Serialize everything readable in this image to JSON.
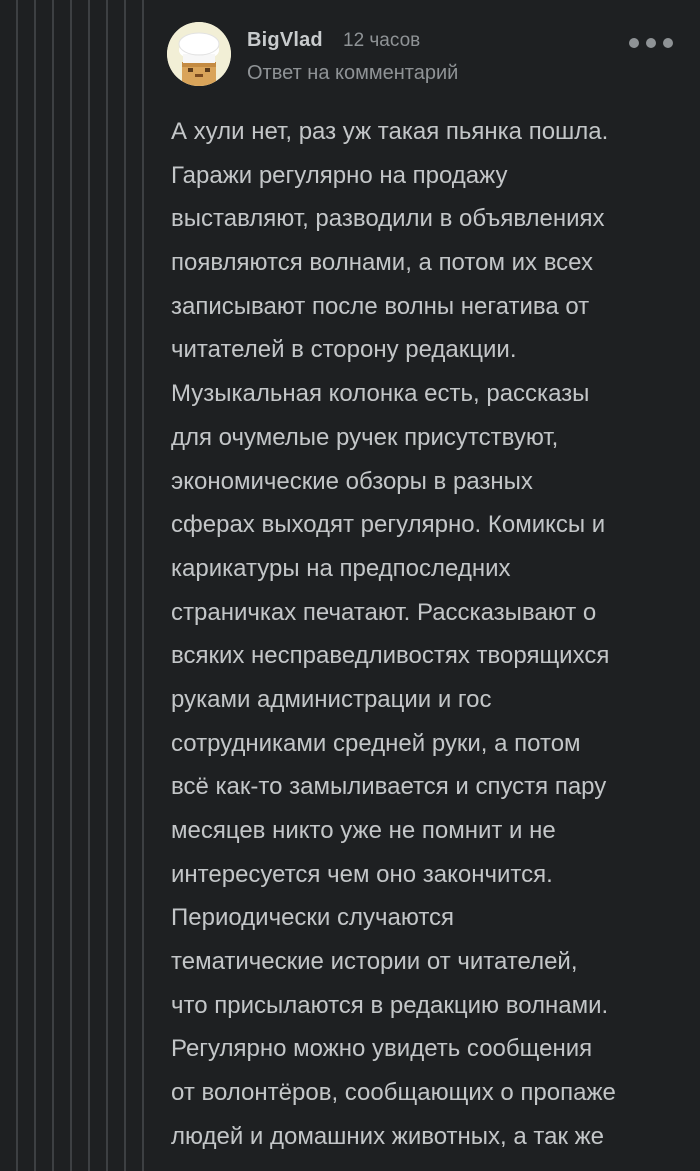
{
  "comment": {
    "author": "BigVlad",
    "timestamp": "12 часов",
    "reply_label": "Ответ на комментарий",
    "avatar_icon": "chef-avatar-icon",
    "more_icon": "more-dots-icon",
    "body_lines": [
      "А хули нет, раз уж такая пьянка пошла.",
      "Гаражи регулярно на продажу",
      "выставляют, разводили в объявлениях",
      "появляются волнами, а потом их всех",
      "записывают после волны негатива от",
      "читателей в сторону редакции.",
      "Музыкальная колонка есть, рассказы",
      "для очумелые ручек присутствуют,",
      "экономические обзоры в разных",
      "сферах выходят регулярно. Комиксы и",
      "карикатуры на предпоследних",
      "страничках печатают. Рассказывают о",
      "всяких несправедливостях творящихся",
      "руками администрации и гос",
      "сотрудниками средней руки, а потом",
      "всё как-то замыливается и спустя пару",
      "месяцев никто уже не помнит и не",
      "интересуется чем оно закончится.",
      "Периодически случаются",
      "тематические истории от читателей,",
      "что присылаются в редакцию волнами.",
      "Регулярно можно увидеть сообщения",
      "от волонтёров, сообщающих о пропаже",
      "людей и домашних животных, а так же"
    ]
  },
  "colors": {
    "background": "#1e2022",
    "thread_line": "#3d4043",
    "author": "#c8cbcd",
    "meta": "#8f9396",
    "body_text": "#c3c6c8"
  }
}
